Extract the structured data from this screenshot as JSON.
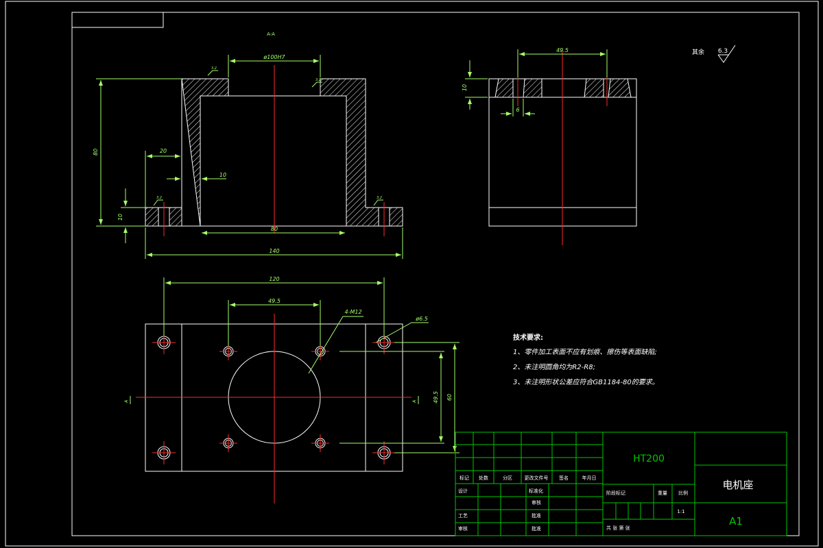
{
  "drawing": {
    "section_label": "A-A",
    "roughness_note": {
      "label": "其余",
      "value": "6.3"
    },
    "roughness_small": "3.2",
    "front_view": {
      "dim_bore": "ø100H7",
      "dim_height": "80",
      "dim_left_20": "20",
      "dim_wall": "10",
      "dim_flange": "10",
      "dim_inner": "80",
      "dim_total": "140"
    },
    "side_view": {
      "dim_top": "49.5",
      "dim_thick": "10",
      "dim_hole": "6"
    },
    "top_view": {
      "dim_120": "120",
      "dim_495": "49.5",
      "dim_thread": "4-M12",
      "dim_hole_dia": "ø6.5",
      "dim_v495": "49.5",
      "dim_v60": "60",
      "section_mark_left": "A",
      "section_mark_right": "A"
    },
    "tech_requirements": {
      "title": "技术要求:",
      "items": [
        "1、零件加工表面不应有划痕、擦伤等表面缺陷;",
        "2、未注明圆角均为R2-R8;",
        "3、未注明形状公差应符合GB1184-80的要求。"
      ]
    }
  },
  "title_block": {
    "material": "HT200",
    "part_name": "电机座",
    "drawing_no": "A1",
    "rev_headers": [
      "标记",
      "处数",
      "分区",
      "更改文件号",
      "签名",
      "年月日"
    ],
    "row_design": "设计",
    "row_standard": "标准化",
    "row_check": "审核",
    "row_process": "工艺",
    "row_approve": "批准",
    "row_verify": "审核",
    "stage_label": "阶段标记",
    "weight_label": "重量",
    "scale_label": "比例",
    "scale_value": "1:1",
    "sheet_text": "共  张  第  张"
  },
  "colors": {
    "background": "#000000",
    "outline": "#ffffff",
    "dimension": "#a6ff6a",
    "centerline": "#ff2a2a",
    "hatch": "#ffffff",
    "title_block": "#00c800"
  }
}
